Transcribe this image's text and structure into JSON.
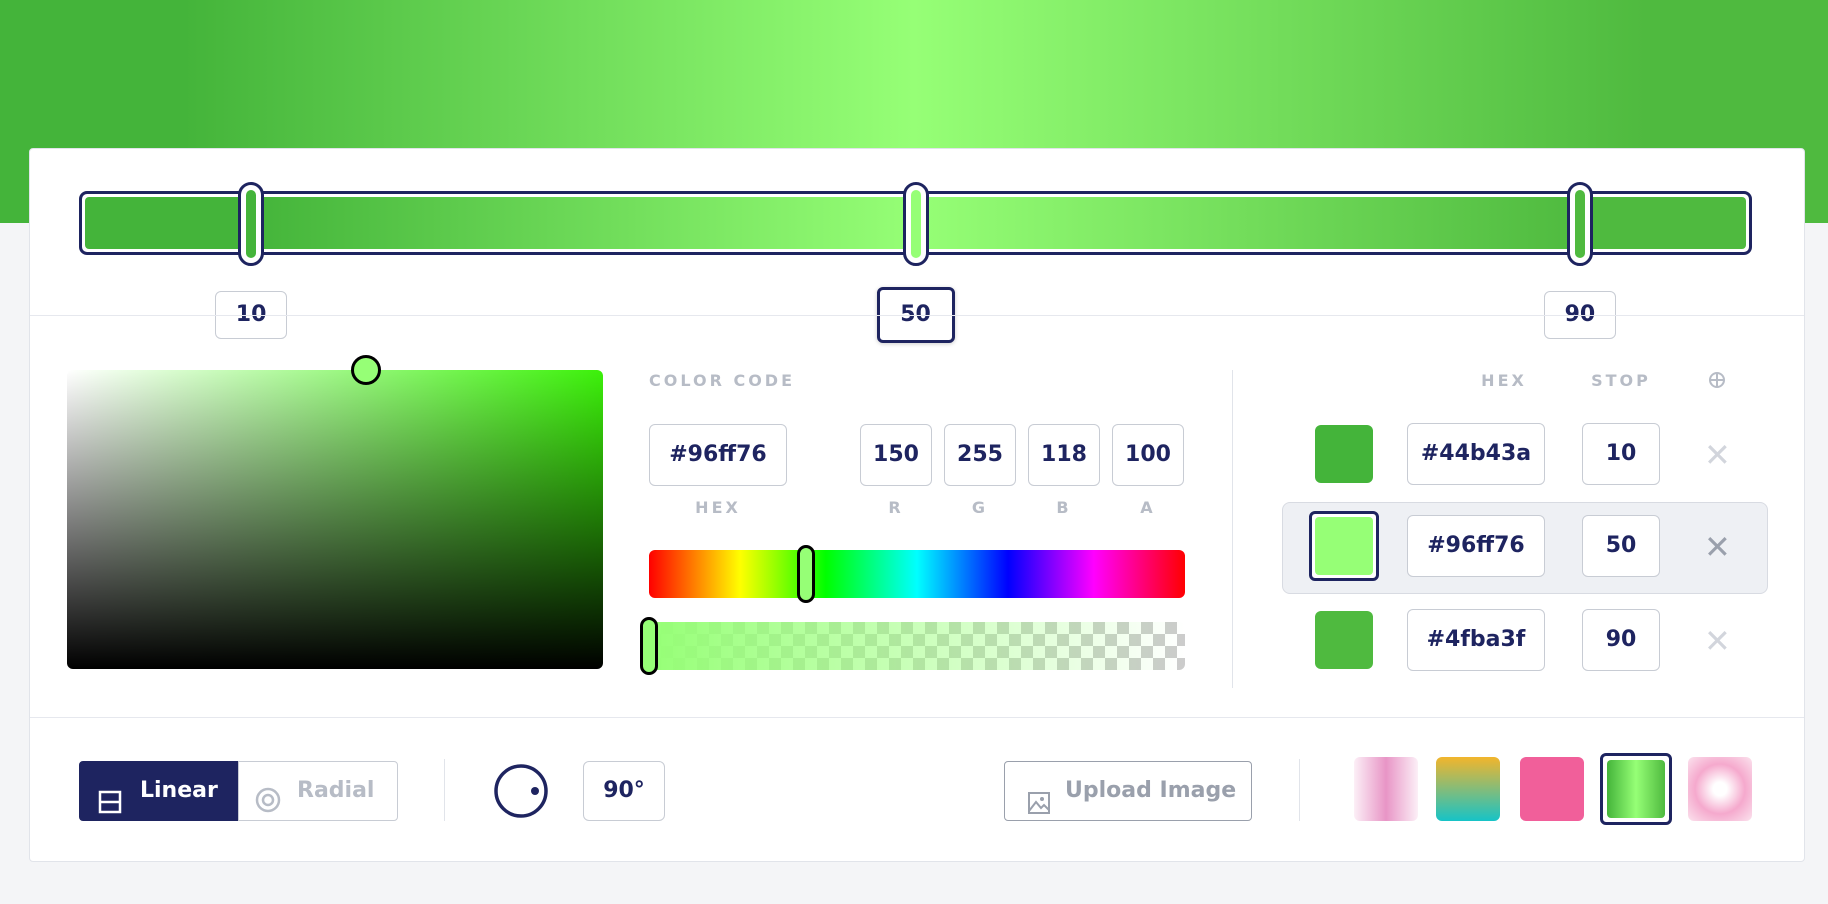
{
  "gradient": {
    "type": "linear",
    "angle": "90°",
    "css": "linear-gradient(90deg, #44b43a 10%, #96ff76 50%, #4fba3f 90%)"
  },
  "stops": [
    {
      "hex": "#44b43a",
      "stop": "10",
      "position": 10,
      "selected": false
    },
    {
      "hex": "#96ff76",
      "stop": "50",
      "position": 50,
      "selected": true
    },
    {
      "hex": "#4fba3f",
      "stop": "90",
      "position": 90,
      "selected": false
    }
  ],
  "color_code": {
    "heading": "COLOR CODE",
    "hex": "#96ff76",
    "r": "150",
    "g": "255",
    "b": "118",
    "a": "100",
    "labels": {
      "hex": "HEX",
      "r": "R",
      "g": "G",
      "b": "B",
      "a": "A"
    }
  },
  "stops_table": {
    "headers": {
      "hex": "HEX",
      "stop": "STOP"
    },
    "add_icon": "crosshair-plus-icon",
    "remove_icon": "close-icon"
  },
  "controls": {
    "linear_label": "Linear",
    "radial_label": "Radial",
    "angle": "90°",
    "upload_label": "Upload Image"
  },
  "presets": [
    {
      "name": "pink-fade",
      "css": "linear-gradient(90deg, rgba(233,149,199,0.15), #e895c6 50%, rgba(233,149,199,0.15))",
      "selected": false
    },
    {
      "name": "gold-teal",
      "css": "linear-gradient(180deg, #f2b52c, #16c3c7)",
      "selected": false
    },
    {
      "name": "pink",
      "css": "#f15f9a",
      "selected": false
    },
    {
      "name": "green",
      "css": "linear-gradient(90deg, #44b43a, #96ff76 50%, #4fba3f)",
      "selected": true
    },
    {
      "name": "pink-radial",
      "css": "radial-gradient(circle, #fff 15%, #f5a9cd 55%, #fbe3ee 100%)",
      "selected": false
    }
  ],
  "colors": {
    "accent": "#1e2460",
    "muted": "#b7bcc6"
  }
}
